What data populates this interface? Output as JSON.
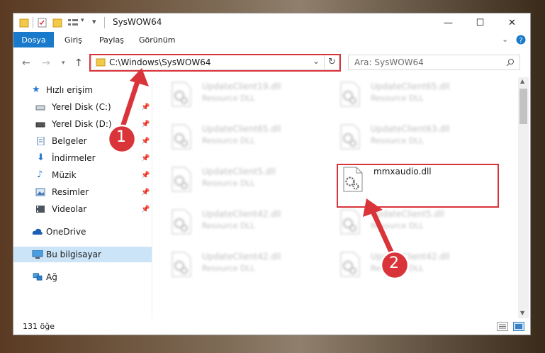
{
  "window": {
    "title": "SysWOW64",
    "controls": {
      "minimize": "—",
      "maximize": "☐",
      "close": "✕"
    }
  },
  "ribbon": {
    "tabs": [
      "Dosya",
      "Giriş",
      "Paylaş",
      "Görünüm"
    ],
    "expand_icon": "chevron-down-icon",
    "help_icon": "help-icon"
  },
  "address": {
    "path": "C:\\Windows\\SysWOW64",
    "search_placeholder": "Ara: SysWOW64"
  },
  "sidebar": {
    "quick_access": "Hızlı erişim",
    "items": [
      {
        "label": "Yerel Disk (C:)",
        "icon": "drive-icon",
        "pinned": true
      },
      {
        "label": "Yerel Disk (D:)",
        "icon": "drive-icon",
        "pinned": true
      },
      {
        "label": "Belgeler",
        "icon": "documents-icon",
        "pinned": true
      },
      {
        "label": "İndirmeler",
        "icon": "download-icon",
        "pinned": true
      },
      {
        "label": "Müzik",
        "icon": "music-icon",
        "pinned": true
      },
      {
        "label": "Resimler",
        "icon": "pictures-icon",
        "pinned": true
      },
      {
        "label": "Videolar",
        "icon": "videos-icon",
        "pinned": true
      }
    ],
    "onedrive": "OneDrive",
    "this_pc": "Bu bilgisayar",
    "network": "Ağ"
  },
  "files": [
    {
      "name": "UpdateClient19.dll",
      "type": "Resource DLL",
      "blurred": true
    },
    {
      "name": "UpdateClient65.dll",
      "type": "Resource DLL",
      "blurred": true
    },
    {
      "name": "UpdateClient65.dll",
      "type": "Resource DLL",
      "blurred": true
    },
    {
      "name": "UpdateClient63.dll",
      "type": "Resource DLL",
      "blurred": true
    },
    {
      "name": "UpdateClient5.dll",
      "type": "Resource DLL",
      "blurred": true
    },
    {
      "name": "mmxaudio.dll",
      "type": "",
      "blurred": false
    },
    {
      "name": "UpdateClient42.dll",
      "type": "Resource DLL",
      "blurred": true
    },
    {
      "name": "UpdateClient5.dll",
      "type": "Resource DLL",
      "blurred": true
    },
    {
      "name": "UpdateClient42.dll",
      "type": "Resource DLL",
      "blurred": true
    },
    {
      "name": "UpdateClient42.dll",
      "type": "Resource DLL",
      "blurred": true
    }
  ],
  "status": {
    "count": "131 öğe"
  },
  "callouts": [
    "1",
    "2"
  ],
  "colors": {
    "accent": "#1979ca",
    "highlight": "#d9343a",
    "selected": "#cce4f7"
  }
}
